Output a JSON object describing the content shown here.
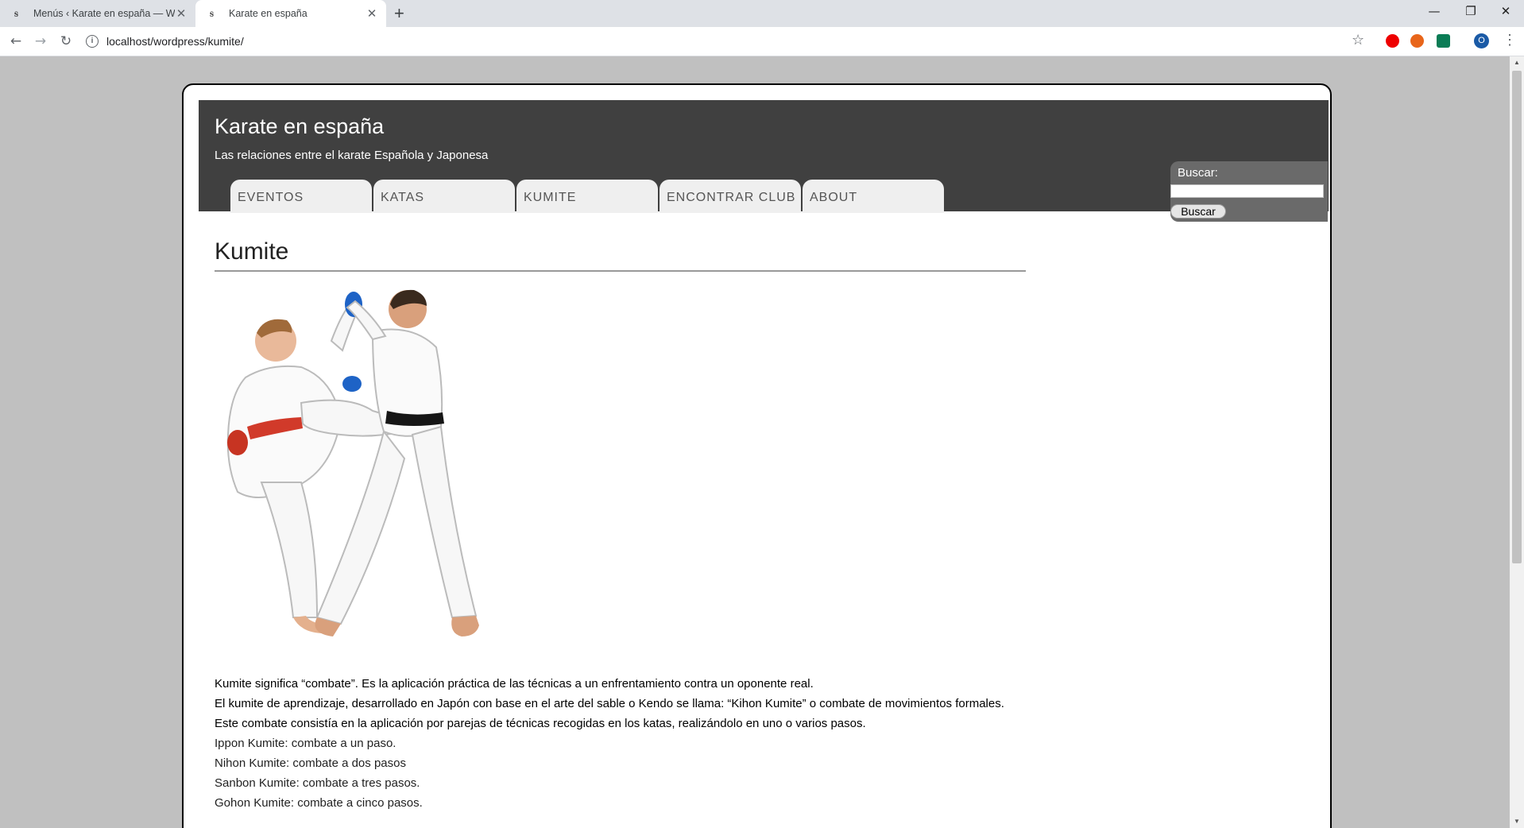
{
  "browser": {
    "tabs": [
      {
        "title": "Menús ‹ Karate en españa — Wo",
        "icon": "site-favicon"
      },
      {
        "title": "Karate en españa",
        "icon": "site-favicon",
        "active": true
      }
    ],
    "url": "localhost/wordpress/kumite/",
    "profile_initial": "O"
  },
  "site": {
    "title": "Karate en españa",
    "description": "Las relaciones entre el karate Española y Japonesa",
    "nav": [
      "EVENTOS",
      "KATAS",
      "KUMITE",
      "ENCONTRAR CLUB",
      "ABOUT"
    ]
  },
  "search": {
    "label": "Buscar:",
    "value": "",
    "button": "Buscar"
  },
  "post": {
    "title": "Kumite",
    "image": "two-karateka-sparring-illustration",
    "paragraphs": [
      "Kumite significa “combate”. Es la aplicación práctica de las técnicas a un enfrentamiento contra un oponente real.",
      "El kumite de aprendizaje, desarrollado en Japón con base en el arte del sable o Kendo se llama: “Kihon Kumite” o combate de movimientos formales.",
      "Este combate consistía en la aplicación por parejas de técnicas recogidas en los katas, realizándolo en uno o varios pasos."
    ],
    "list": [
      "Ippon Kumite: combate a un paso.",
      "Nihon Kumite: combate a dos pasos",
      "Sanbon Kumite: combate a tres pasos.",
      "Gohon Kumite: combate a cinco pasos."
    ]
  },
  "colors": {
    "header_bg": "#404040",
    "nav_bg": "#efefef",
    "page_bg": "#c0c0c0"
  }
}
